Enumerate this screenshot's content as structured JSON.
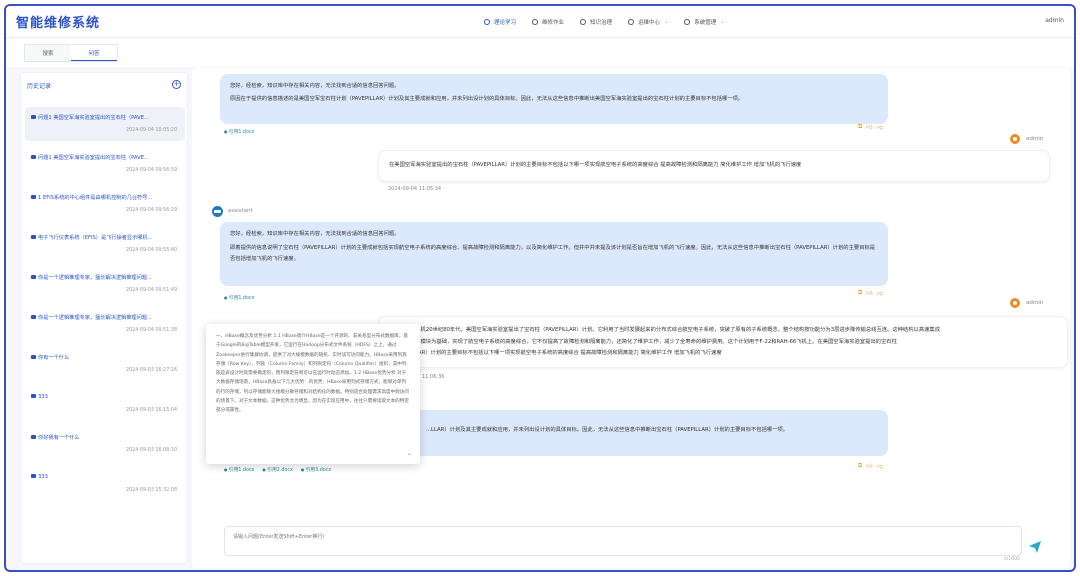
{
  "app": {
    "title": "智能维修系统",
    "user": "admin"
  },
  "nav": [
    {
      "label": "理论学习",
      "icon": "book-icon",
      "active": true
    },
    {
      "label": "维修作业",
      "icon": "wrench-icon"
    },
    {
      "label": "知识治理",
      "icon": "link-icon"
    },
    {
      "label": "运维中心",
      "icon": "monitor-icon",
      "caret": "⌄"
    },
    {
      "label": "系统管理",
      "icon": "gear-icon",
      "caret": "⌄"
    }
  ],
  "tabs": [
    {
      "label": "搜索"
    },
    {
      "label": "问答",
      "active": true
    }
  ],
  "sidebar": {
    "title": "历史记录",
    "add_icon": "plus-circle-icon",
    "items": [
      {
        "title": "问题1 美国空军海实验室提出的宝石柱（PAVE...",
        "time": "2024-09-04 10:05:20"
      },
      {
        "title": "问题1 美国空军海实验室提出的宝石柱（PAVE...",
        "time": "2024-09-04 09:56:59"
      },
      {
        "title": "1 EFIS系统的中心组件是由哪机控制的几台符号...",
        "time": "2024-09-04 09:56:29"
      },
      {
        "title": "电子飞行仪表系统（EFIS）是飞行操者显示哪机...",
        "time": "2024-09-04 09:55:40"
      },
      {
        "title": "你是一个逻辑推理专家，擅长解决逻辑推理问题...",
        "time": "2024-09-04 09:51:49"
      },
      {
        "title": "你是一个逻辑推理专家，擅长解决逻辑推理问题...",
        "time": "2024-09-04 09:51:38"
      },
      {
        "title": "你有一个什么",
        "time": "2024-09-03 16:27:26"
      },
      {
        "title": "333",
        "time": "2024-09-03 16:15:04"
      },
      {
        "title": "你好我有一个什么",
        "time": "2024-09-03 16:08:30"
      },
      {
        "title": "333",
        "time": "2024-09-03 15:32:08"
      }
    ]
  },
  "chat": {
    "msg1": {
      "line1": "您好，经检索，知识库中存在相关内容，无法找到合适的信息回答问题。",
      "line2": "原因在于提供的信息描述的是美国空军宝石柱计划（PAVEPILLAR）计划及其主要成就和应用，并未列出设计划的具体目标。因此，无法从这些信息中推断出美国空军海实验室提出的宝石柱计划的主要目标不包括哪一项。",
      "sources": [
        "引用1.docx"
      ]
    },
    "msg2": {
      "sender": "admin",
      "text": "在美国空军海实验室提出的宝石柱（PAVEPILLAR）计划的主要目标不包括以下哪一项实现航空电子系统的高度综合 提高故障检测和隔离能力 简化维护工作 增加飞机的飞行速度",
      "time": "2024-09-04 11:05:34"
    },
    "msg3": {
      "sender": "assistant",
      "line1": "您好，经检索，知识库中存在相关内容，无法找到合适的信息回答问题。",
      "line2": "即着提供的信息说明了宝石柱（PAVEPILLAR）计划的主要成就包括实现航空电子系统的高度综合、提高故障检测和隔离能力，以及简化维护工作。但并中并未提及该计划是否旨在增加飞机的飞行速度。因此，无法从这些信息中推断出宝石柱（PAVEPILLAR）计划的主要目标是否包括增加飞机的飞行速度。",
      "sources": [
        "引用1.docx"
      ]
    },
    "msg4": {
      "sender": "admin",
      "text_a": "...式机载计算机20世纪80年代，美国空军海实验室提出了宝石柱（PAVEPILLAR）计划。它利用了当时发展起来的分布式综合航空电子系统，突破了原有的子系统概念，整个结构按功能分为3层进步降传输总线互连。这种结构以高速集成",
      "text_b": "...IC）和通用模块为基础，实现了航空电子系统的高度综合，它不仅提高了故障检测和隔离能力，还简化了维护工作，减少了全寿命的维护费用。这个计划用于F-22和RAH-66飞机上。在美国空军海实验室提出的宝石柱",
      "text_c": "...PAVEPILLAR）计划的主要目标不包括以下哪一项实现航空电子系统的高度综合 提高故障检测和隔离能力 简化维护工作 增加飞机的飞行速度",
      "time": "11:06:36"
    },
    "msg5": {
      "line": "...LLAR）计划及其主要成就和应用，并未列出设计划的具体目标。因此，无法从这些信息中推断出宝石柱（PAVEPILLAR）计划的主要目标不包括哪一项。",
      "sources": [
        "引用1.docx",
        "引用2.docx",
        "引用3.docx"
      ]
    },
    "action_icons": [
      "copy-icon",
      "thumbs-up-icon",
      "thumbs-down-icon"
    ]
  },
  "popup": {
    "text": "一、HBase概念及优势分析 1.1 HBase简介HBase是一个开源的、非关系型分布式数据库，基于Google的BigTable模型开发，它运行在Hadoop分布式文件系统（HDFS）之上，通过Zookeeper进行集群协调，提供了对大规模数据的随机、实时读写访问能力。HBase采用列族存储（Row Key）、列族（Column Family）和列限定符（Column Qualifier）组织，其中列族是表设计时就需要确定的，而列限定符则可以在运行时动态添加。1.2 HBase优势分析 对于大数据存储场景，HBase具备以下几大优势：的优势：HBase采用列式存储方式，能够对单列的行的存储，列以存储能够大规模分散存储和对结构化的数据。特别适合处理需求高度中频访问的场景下。对于文本数据，这种优势尤为明显。因为在实际应用中，往往只需要读取文本的特定部分或属性。",
    "close": "⌄"
  },
  "input": {
    "placeholder": "请输入问题(Enter发送Shift+Enter换行)",
    "counter": "0/1000"
  },
  "colors": {
    "accent": "#2b53c9",
    "bubble": "#dce8fb",
    "admin_avatar": "#f08c28",
    "bot_avatar": "#1f78c8",
    "send": "#20a8c8"
  }
}
